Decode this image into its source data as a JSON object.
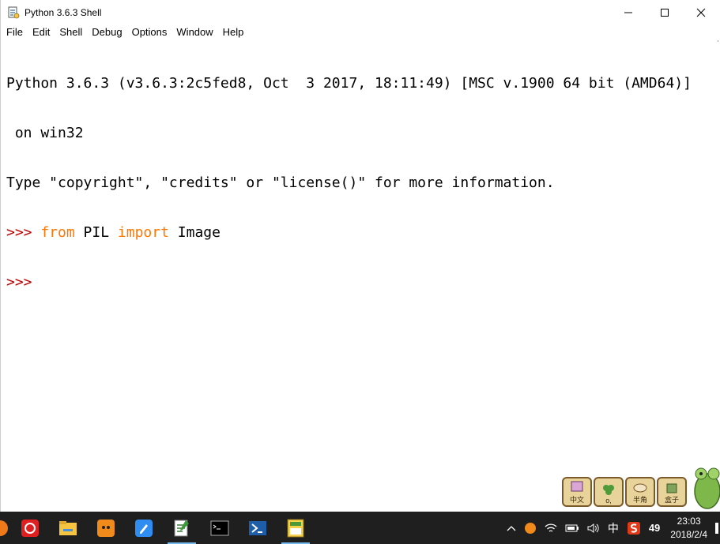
{
  "window": {
    "title": "Python 3.6.3 Shell"
  },
  "menu": [
    "File",
    "Edit",
    "Shell",
    "Debug",
    "Options",
    "Window",
    "Help"
  ],
  "shell": {
    "line1": "Python 3.6.3 (v3.6.3:2c5fed8, Oct  3 2017, 18:11:49) [MSC v.1900 64 bit (AMD64)]",
    "line2": " on win32",
    "line3": "Type \"copyright\", \"credits\" or \"license()\" for more information.",
    "prompt": ">>> ",
    "cmd_from": "from",
    "cmd_module": " PIL ",
    "cmd_import": "import",
    "cmd_name": " Image"
  },
  "pets": [
    {
      "label": "中文",
      "icon": "book-icon"
    },
    {
      "label": "o,",
      "icon": "clover-icon"
    },
    {
      "label": "半角",
      "icon": "bowl-icon"
    },
    {
      "label": "盒子",
      "icon": "bag-icon"
    }
  ],
  "taskbar": {
    "apps": [
      "firefox-icon",
      "netease-music-icon",
      "file-explorer-icon",
      "pumpkin-app-icon",
      "pen-app-icon",
      "notepad-icon",
      "cmd-icon",
      "powershell-icon",
      "calculator-app-icon"
    ]
  },
  "tray": {
    "ime_lang": "中",
    "badge": "49",
    "time": "23:03",
    "date": "2018/2/4"
  },
  "colors": {
    "prompt": "#c00000",
    "keyword": "#ff7700",
    "taskbar": "#1f1f1f"
  }
}
